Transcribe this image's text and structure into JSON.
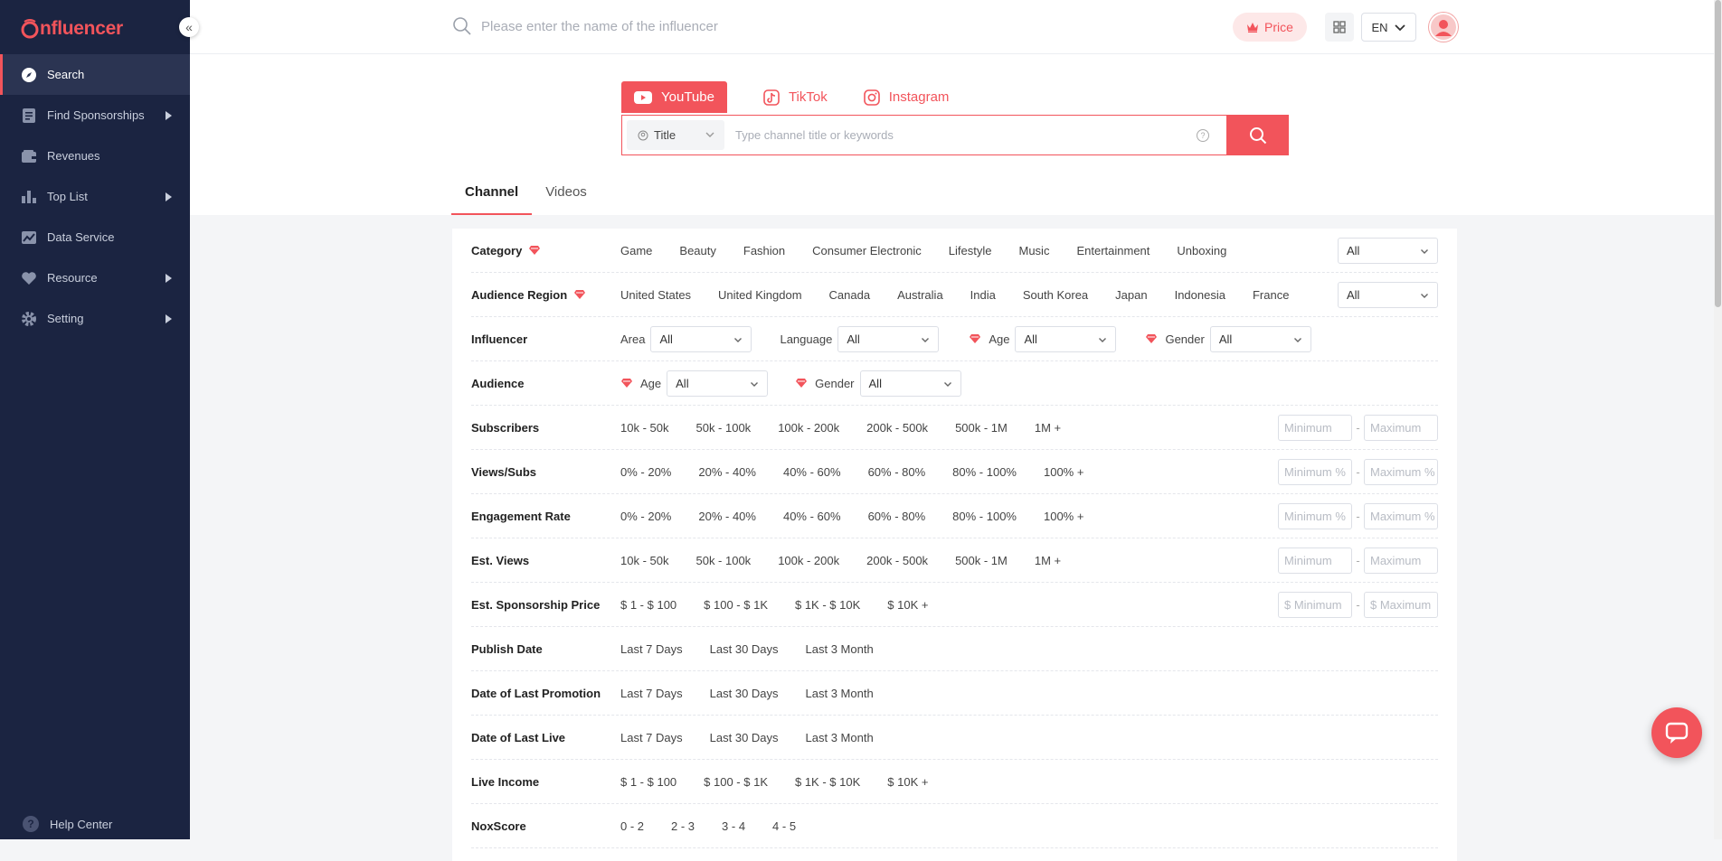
{
  "brand": {
    "logo_text": "nfluencer",
    "accent": "#f2545b",
    "sidebar_bg": "#1b2441"
  },
  "sidebar": {
    "collapse_icon": "«",
    "items": [
      {
        "label": "Search",
        "icon": "compass-icon",
        "active": true
      },
      {
        "label": "Find Sponsorships",
        "icon": "document-icon",
        "has_submenu": true
      },
      {
        "label": "Revenues",
        "icon": "wallet-icon"
      },
      {
        "label": "Top List",
        "icon": "bar-chart-icon",
        "has_submenu": true
      },
      {
        "label": "Data Service",
        "icon": "line-chart-icon"
      },
      {
        "label": "Resource",
        "icon": "heart-icon",
        "has_submenu": true
      },
      {
        "label": "Setting",
        "icon": "gear-icon",
        "has_submenu": true
      }
    ],
    "help_label": "Help Center"
  },
  "topbar": {
    "search_placeholder": "Please enter the name of the influencer",
    "price_label": "Price",
    "lang_label": "EN"
  },
  "platforms": {
    "tabs": [
      {
        "label": "YouTube",
        "icon": "youtube-icon",
        "active": true
      },
      {
        "label": "TikTok",
        "icon": "tiktok-icon"
      },
      {
        "label": "Instagram",
        "icon": "instagram-icon"
      }
    ],
    "field_select": "Title",
    "keyword_placeholder": "Type channel title or keywords"
  },
  "result_tabs": [
    {
      "label": "Channel",
      "active": true
    },
    {
      "label": "Videos"
    }
  ],
  "filters": {
    "category": {
      "label": "Category",
      "options": [
        "Game",
        "Beauty",
        "Fashion",
        "Consumer Electronic",
        "Lifestyle",
        "Music",
        "Entertainment",
        "Unboxing"
      ],
      "select": "All"
    },
    "audience_region": {
      "label": "Audience Region",
      "options": [
        "United States",
        "United Kingdom",
        "Canada",
        "Australia",
        "India",
        "South Korea",
        "Japan",
        "Indonesia",
        "France"
      ],
      "select": "All"
    },
    "influencer": {
      "label": "Influencer",
      "area_label": "Area",
      "area": "All",
      "language_label": "Language",
      "language": "All",
      "age_label": "Age",
      "age": "All",
      "gender_label": "Gender",
      "gender": "All"
    },
    "audience": {
      "label": "Audience",
      "age_label": "Age",
      "age": "All",
      "gender_label": "Gender",
      "gender": "All"
    },
    "subscribers": {
      "label": "Subscribers",
      "options": [
        "10k - 50k",
        "50k - 100k",
        "100k - 200k",
        "200k - 500k",
        "500k - 1M",
        "1M +"
      ],
      "min": "Minimum",
      "max": "Maximum"
    },
    "views_subs": {
      "label": "Views/Subs",
      "options": [
        "0% - 20%",
        "20% - 40%",
        "40% - 60%",
        "60% - 80%",
        "80% - 100%",
        "100% +"
      ],
      "min": "Minimum %",
      "max": "Maximum %"
    },
    "engagement_rate": {
      "label": "Engagement Rate",
      "options": [
        "0% - 20%",
        "20% - 40%",
        "40% - 60%",
        "60% - 80%",
        "80% - 100%",
        "100% +"
      ],
      "min": "Minimum %",
      "max": "Maximum %"
    },
    "est_views": {
      "label": "Est. Views",
      "options": [
        "10k - 50k",
        "50k - 100k",
        "100k - 200k",
        "200k - 500k",
        "500k - 1M",
        "1M +"
      ],
      "min": "Minimum",
      "max": "Maximum"
    },
    "est_sponsorship_price": {
      "label": "Est. Sponsorship Price",
      "options": [
        "$ 1 - $ 100",
        "$ 100 - $ 1K",
        "$ 1K - $ 10K",
        "$ 10K +"
      ],
      "min": "$ Minimum",
      "max": "$ Maximum"
    },
    "publish_date": {
      "label": "Publish Date",
      "options": [
        "Last 7 Days",
        "Last 30 Days",
        "Last 3 Month"
      ]
    },
    "date_last_promotion": {
      "label": "Date of Last Promotion",
      "options": [
        "Last 7 Days",
        "Last 30 Days",
        "Last 3 Month"
      ]
    },
    "date_last_live": {
      "label": "Date of Last Live",
      "options": [
        "Last 7 Days",
        "Last 30 Days",
        "Last 3 Month"
      ]
    },
    "live_income": {
      "label": "Live Income",
      "options": [
        "$ 1 - $ 100",
        "$ 100 - $ 1K",
        "$ 1K - $ 10K",
        "$ 10K +"
      ]
    },
    "noxscore": {
      "label": "NoxScore",
      "options": [
        "0 - 2",
        "2 - 3",
        "3 - 4",
        "4 - 5"
      ]
    },
    "range_dash": "-"
  }
}
